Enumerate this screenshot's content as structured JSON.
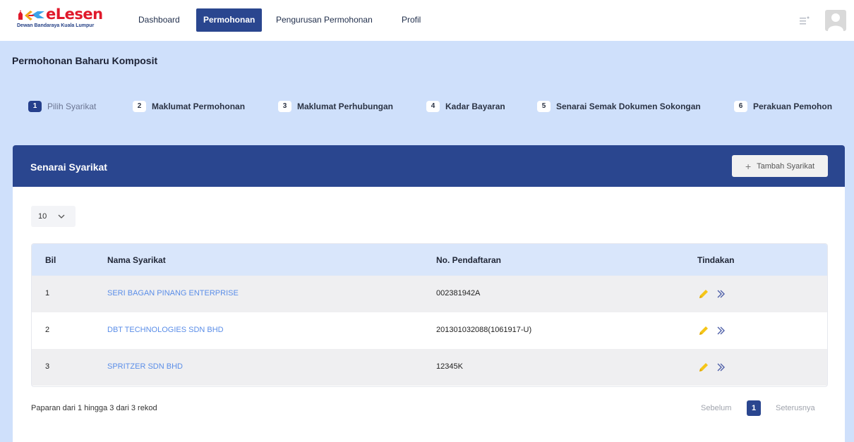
{
  "brand": {
    "name": "eLesen",
    "subtitle": "Dewan Bandaraya Kuala Lumpur"
  },
  "nav": {
    "items": [
      {
        "label": "Dashboard",
        "active": false
      },
      {
        "label": "Permohonan",
        "active": true
      },
      {
        "label": "Pengurusan Permohonan",
        "active": false
      },
      {
        "label": "Profil",
        "active": false
      }
    ]
  },
  "page": {
    "title": "Permohonan Baharu Komposit"
  },
  "steps": [
    {
      "num": "1",
      "label": "Pilih Syarikat",
      "active": true
    },
    {
      "num": "2",
      "label": "Maklumat Permohonan",
      "active": false
    },
    {
      "num": "3",
      "label": "Maklumat Perhubungan",
      "active": false
    },
    {
      "num": "4",
      "label": "Kadar Bayaran",
      "active": false
    },
    {
      "num": "5",
      "label": "Senarai Semak Dokumen Sokongan",
      "active": false
    },
    {
      "num": "6",
      "label": "Perakuan Pemohon",
      "active": false
    }
  ],
  "card": {
    "title": "Senarai Syarikat",
    "add_button": "Tambah Syarikat",
    "page_size": "10"
  },
  "table": {
    "headers": {
      "bil": "Bil",
      "nama": "Nama Syarikat",
      "no": "No. Pendaftaran",
      "tindakan": "Tindakan"
    },
    "rows": [
      {
        "bil": "1",
        "nama": "SERI BAGAN PINANG ENTERPRISE",
        "no": "002381942A"
      },
      {
        "bil": "2",
        "nama": "DBT TECHNOLOGIES SDN BHD",
        "no": "201301032088(1061917-U)"
      },
      {
        "bil": "3",
        "nama": "SPRITZER SDN BHD",
        "no": "12345K"
      }
    ]
  },
  "footer": {
    "info": "Paparan dari 1 hingga 3 dari 3 rekod",
    "prev": "Sebelum",
    "current_page": "1",
    "next": "Seterusnya"
  },
  "colors": {
    "primary": "#2a468f",
    "page_bg": "#cfe0fb",
    "link": "#5b8ee8",
    "edit_icon": "#f5c518"
  },
  "icons": {
    "edit": "pencil-icon",
    "go": "chevron-right-double-icon",
    "menu": "menu-icon",
    "avatar": "user-avatar-icon"
  }
}
